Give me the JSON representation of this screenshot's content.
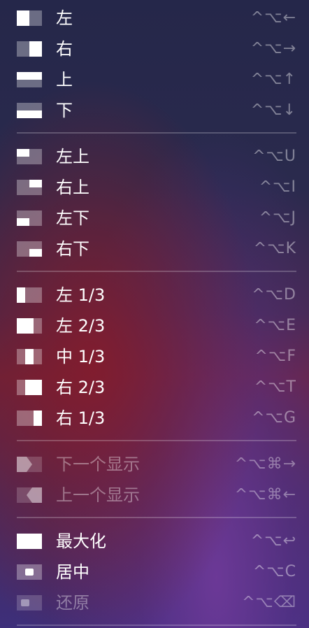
{
  "menu": {
    "items": [
      {
        "label": "左",
        "shortcut": "^⌥←"
      },
      {
        "label": "右",
        "shortcut": "^⌥→"
      },
      {
        "label": "上",
        "shortcut": "^⌥↑"
      },
      {
        "label": "下",
        "shortcut": "^⌥↓"
      },
      {
        "label": "左上",
        "shortcut": "^⌥U"
      },
      {
        "label": "右上",
        "shortcut": "^⌥I"
      },
      {
        "label": "左下",
        "shortcut": "^⌥J"
      },
      {
        "label": "右下",
        "shortcut": "^⌥K"
      },
      {
        "label": "左 1/3",
        "shortcut": "^⌥D"
      },
      {
        "label": "左 2/3",
        "shortcut": "^⌥E"
      },
      {
        "label": "中 1/3",
        "shortcut": "^⌥F"
      },
      {
        "label": "右 2/3",
        "shortcut": "^⌥T"
      },
      {
        "label": "右 1/3",
        "shortcut": "^⌥G"
      },
      {
        "label": "下一个显示",
        "shortcut": "^⌥⌘→",
        "disabled": true
      },
      {
        "label": "上一个显示",
        "shortcut": "^⌥⌘←",
        "disabled": true
      },
      {
        "label": "最大化",
        "shortcut": "^⌥↩"
      },
      {
        "label": "居中",
        "shortcut": "^⌥C"
      },
      {
        "label": "还原",
        "shortcut": "^⌥⌫",
        "disabled": true
      }
    ]
  }
}
